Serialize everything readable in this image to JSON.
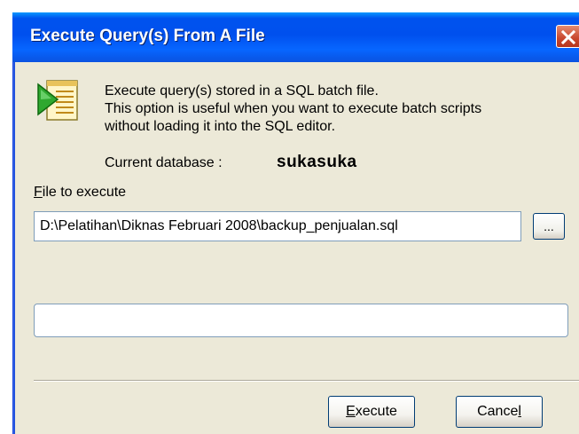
{
  "window": {
    "title": "Execute Query(s) From A File",
    "close_icon": "close-icon"
  },
  "description": {
    "icon": "sql-batch-file-icon",
    "line1": "Execute query(s) stored in a SQL batch file.",
    "line2": "This option is useful when you want to execute batch scripts",
    "line3": "without loading it into the SQL editor."
  },
  "database": {
    "label": "Current database :",
    "value": "sukasuka"
  },
  "file": {
    "label_accel": "F",
    "label_rest": "ile to execute",
    "value": "D:\\Pelatihan\\Diknas Februari 2008\\backup_penjualan.sql",
    "browse_label": "..."
  },
  "progress": {
    "value": 0
  },
  "buttons": {
    "execute_accel": "E",
    "execute_rest": "xecute",
    "cancel_main": "Cance",
    "cancel_accel": "l"
  },
  "colors": {
    "titlebar": "#0054e3",
    "dialog_bg": "#ece9d8",
    "close_button": "#c9472e",
    "progress_fill": "#2fb42f"
  }
}
